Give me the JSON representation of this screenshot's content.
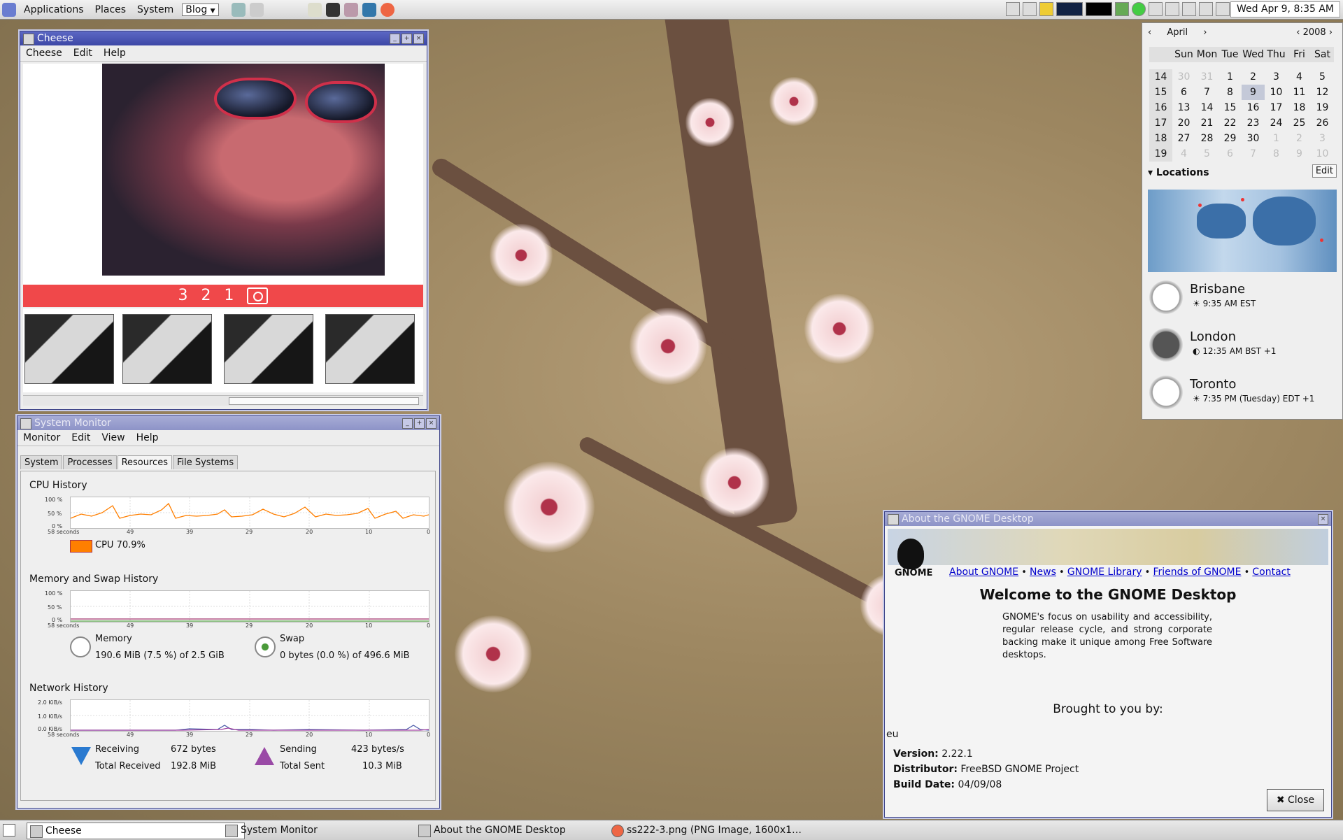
{
  "top_panel": {
    "menus": [
      "Applications",
      "Places",
      "System"
    ],
    "blog_dropdown": "Blog",
    "clock": "Wed Apr  9,  8:35 AM"
  },
  "cheese": {
    "title": "Cheese",
    "menu": [
      "Cheese",
      "Edit",
      "Help"
    ],
    "countdown": "3 2 1"
  },
  "sysmon": {
    "title": "System Monitor",
    "menu": [
      "Monitor",
      "Edit",
      "View",
      "Help"
    ],
    "tabs": [
      "System",
      "Processes",
      "Resources",
      "File Systems"
    ],
    "active_tab": "Resources",
    "x_ticks": [
      "58 seconds",
      "49",
      "39",
      "29",
      "20",
      "10",
      "0"
    ],
    "cpu": {
      "title": "CPU History",
      "y_ticks": [
        "100 %",
        "50 %",
        "0 %"
      ],
      "legend": "CPU 70.9%",
      "color": "#ff7f00"
    },
    "memory": {
      "title": "Memory and Swap History",
      "y_ticks": [
        "100 %",
        "50 %",
        "0 %"
      ],
      "mem_label": "Memory",
      "mem_value": "190.6 MiB (7.5 %) of 2.5 GiB",
      "swap_label": "Swap",
      "swap_value": "0 bytes (0.0 %) of 496.6 MiB"
    },
    "network": {
      "title": "Network History",
      "y_ticks": [
        "2.0 KiB/s",
        "1.0 KiB/s",
        "0.0 KiB/s"
      ],
      "receiving_label": "Receiving",
      "receiving_value": "672 bytes",
      "total_received_label": "Total Received",
      "total_received_value": "192.8 MiB",
      "sending_label": "Sending",
      "sending_value": "423 bytes/s",
      "total_sent_label": "Total Sent",
      "total_sent_value": "10.3 MiB"
    }
  },
  "calendar": {
    "month": "April",
    "year": "2008",
    "weekdays": [
      "Sun",
      "Mon",
      "Tue",
      "Wed",
      "Thu",
      "Fri",
      "Sat"
    ],
    "weeks": [
      {
        "wk": "14",
        "days": [
          "30",
          "31",
          "1",
          "2",
          "3",
          "4",
          "5"
        ]
      },
      {
        "wk": "15",
        "days": [
          "6",
          "7",
          "8",
          "9",
          "10",
          "11",
          "12"
        ]
      },
      {
        "wk": "16",
        "days": [
          "13",
          "14",
          "15",
          "16",
          "17",
          "18",
          "19"
        ]
      },
      {
        "wk": "17",
        "days": [
          "20",
          "21",
          "22",
          "23",
          "24",
          "25",
          "26"
        ]
      },
      {
        "wk": "18",
        "days": [
          "27",
          "28",
          "29",
          "30",
          "1",
          "2",
          "3"
        ]
      },
      {
        "wk": "19",
        "days": [
          "4",
          "5",
          "6",
          "7",
          "8",
          "9",
          "10"
        ]
      }
    ],
    "today": "9",
    "locations_label": "Locations",
    "edit_label": "Edit",
    "locations": [
      {
        "name": "Brisbane",
        "time": "9:35 AM EST"
      },
      {
        "name": "London",
        "time": "12:35 AM BST +1"
      },
      {
        "name": "Toronto",
        "time": "7:35 PM (Tuesday) EDT +1"
      }
    ]
  },
  "about": {
    "title": "About the GNOME Desktop",
    "logo_text": "GNOME",
    "links": [
      "About GNOME",
      "News",
      "GNOME Library",
      "Friends of GNOME",
      "Contact"
    ],
    "heading": "Welcome to the GNOME Desktop",
    "description": "GNOME's focus on usability and accessibility, regular release cycle, and strong corporate backing make it unique among Free Software desktops.",
    "brought": "Brought to you by:",
    "partial_name": "eu",
    "version_label": "Version:",
    "version": "2.22.1",
    "distributor_label": "Distributor:",
    "distributor": "FreeBSD GNOME Project",
    "build_label": "Build Date:",
    "build_date": "04/09/08",
    "close_label": "Close"
  },
  "taskbar": [
    {
      "label": "Cheese",
      "active": true
    },
    {
      "label": "System Monitor",
      "active": false
    },
    {
      "label": "About the GNOME Desktop",
      "active": false
    },
    {
      "label": "ss222-3.png (PNG Image, 1600x1…",
      "active": false
    }
  ]
}
